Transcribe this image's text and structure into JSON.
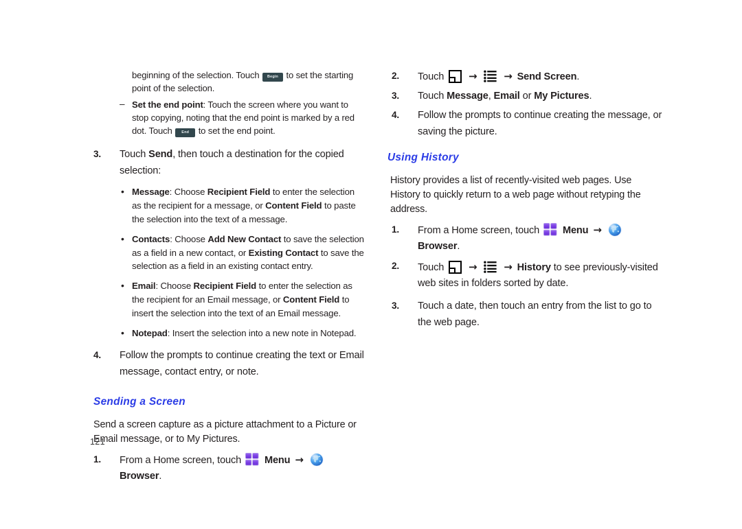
{
  "page": {
    "folio": "121"
  },
  "left_column": {
    "step2_continuation": {
      "pre": "beginning of the selection. Touch",
      "key": "Begin",
      "post": "to set the starting point of the selection."
    },
    "dash_item": {
      "bold": "Set the end point",
      "text_1": ": Touch the screen where you want to stop copying, noting that the end point is marked by a red dot.  Touch",
      "key": "End",
      "text_2": "to set the end point."
    },
    "step3": {
      "num": "3.",
      "part1": "Touch ",
      "bold1": "Send",
      "part2": ", then touch a destination for the copied selection:"
    },
    "bullets": [
      {
        "label": "Message",
        "seg1": ": Choose ",
        "bold1": "Recipient Field",
        "seg2": " to enter the selection as the recipient for a message, or ",
        "bold2": "Content Field",
        "seg3": " to paste the selection into the text of a message."
      },
      {
        "label": "Contacts",
        "seg1": ": Choose ",
        "bold1": "Add New Contact",
        "seg2": " to save the selection as a field in a new contact, or ",
        "bold2": "Existing Contact",
        "seg3": " to save the selection as a field in an existing contact entry."
      },
      {
        "label": "Email",
        "seg1": ": Choose ",
        "bold1": "Recipient Field",
        "seg2": " to enter the selection as the recipient for an Email message, or ",
        "bold2": "Content Field",
        "seg3": " to insert the selection into the text of an Email message."
      },
      {
        "label": "Notepad",
        "seg1": ": Insert the selection into a new note in Notepad.",
        "bold1": "",
        "seg2": "",
        "bold2": "",
        "seg3": ""
      }
    ],
    "step4": {
      "num": "4.",
      "text": "Follow the prompts to continue creating the text or Email message, contact entry, or note."
    },
    "heading_sending": "Sending a Screen",
    "sending_para": "Send a screen capture as a picture attachment to a Picture or Email message, or to My Pictures.",
    "sending_step1": {
      "num": "1.",
      "pre": "From a Home screen, touch",
      "menu_label": "Menu",
      "arrow": "→",
      "browser_label": "Browser",
      "period": "."
    }
  },
  "right_column": {
    "step2": {
      "num": "2.",
      "pre": "Touch",
      "arrow1": "→",
      "arrow2": "→",
      "bold": "Send Screen",
      "period": "."
    },
    "step3": {
      "num": "3.",
      "pre": "Touch ",
      "b1": "Message",
      "sep1": ", ",
      "b2": "Email",
      "sep2": " or ",
      "b3": "My Pictures",
      "period": "."
    },
    "step4": {
      "num": "4.",
      "text": "Follow the prompts to continue creating the message, or saving the picture."
    },
    "heading_history": "Using History",
    "history_para": "History provides a list of recently-visited web pages.  Use History to quickly return to a web page without retyping the address.",
    "history_step1": {
      "num": "1.",
      "pre": "From a Home screen, touch",
      "menu_label": "Menu",
      "arrow": "→",
      "browser_label": "Browser",
      "period": "."
    },
    "history_step2": {
      "num": "2.",
      "pre": "Touch",
      "arrow1": "→",
      "arrow2": "→",
      "bold": "History",
      "post": " to see previously-visited web sites in folders sorted by date."
    },
    "history_step3": {
      "num": "3.",
      "text": "Touch a date, then touch an entry from the list to go to the web page."
    }
  },
  "icons": {
    "screen_icon": "screen-icon",
    "list_icon": "options-list-icon",
    "menu_icon": "menu-grid-icon",
    "browser_icon": "browser-globe-icon"
  },
  "colors": {
    "heading_blue": "#2b3ce6",
    "menu_purple": "#7b3fe4",
    "globe_blue": "#2f7de0",
    "key_dark": "#32474d",
    "body_black": "#231f20"
  }
}
